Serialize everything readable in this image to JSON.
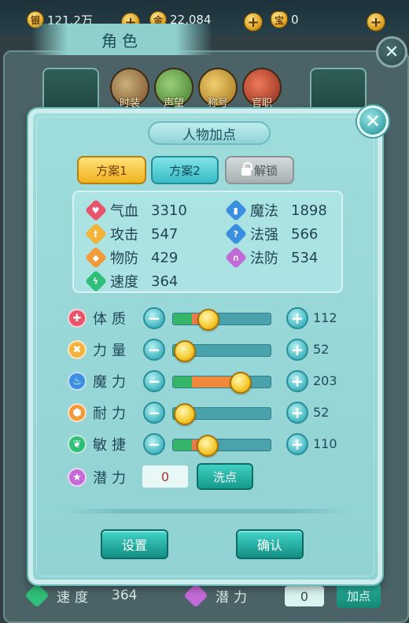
{
  "currency": {
    "silver": "121.2万",
    "gold": "22,084",
    "ingot": "0"
  },
  "background": {
    "title": "角色",
    "icons": [
      "时装",
      "声望",
      "称号",
      "官职"
    ],
    "bottom_row": {
      "speed_label": "速度",
      "speed_value": "364",
      "potential_label": "潜力",
      "potential_value": "0",
      "add_button": "加点"
    }
  },
  "dialog": {
    "title": "人物加点",
    "tabs": [
      {
        "label": "方案1",
        "state": "active"
      },
      {
        "label": "方案2",
        "state": "normal"
      },
      {
        "label": "解锁",
        "state": "locked"
      }
    ],
    "stats": [
      {
        "label": "气血",
        "value": "3310",
        "color": "#e8556b"
      },
      {
        "label": "魔法",
        "value": "1898",
        "color": "#3b8fe0"
      },
      {
        "label": "攻击",
        "value": "547",
        "color": "#f2b33a"
      },
      {
        "label": "法强",
        "value": "566",
        "color": "#3b8fe0"
      },
      {
        "label": "物防",
        "value": "429",
        "color": "#f29a3a"
      },
      {
        "label": "法防",
        "value": "534",
        "color": "#c46ad6"
      },
      {
        "label": "速度",
        "value": "364",
        "color": "#2fbf78"
      }
    ],
    "attributes": [
      {
        "label": "体质",
        "value": "112",
        "level": 0.36,
        "fill_color": "#e77b4a",
        "icon": "cross-icon",
        "icon_color": "#e8556b"
      },
      {
        "label": "力量",
        "value": "52",
        "level": 0.12,
        "fill_color": "#e77b4a",
        "icon": "swords-icon",
        "icon_color": "#f2b33a"
      },
      {
        "label": "魔力",
        "value": "203",
        "level": 0.68,
        "fill_color": "#ef8a3c",
        "icon": "flame-icon",
        "icon_color": "#3b8fe0"
      },
      {
        "label": "耐力",
        "value": "52",
        "level": 0.12,
        "fill_color": "#e77b4a",
        "icon": "shield-icon",
        "icon_color": "#f29a3a"
      },
      {
        "label": "敏捷",
        "value": "110",
        "level": 0.35,
        "fill_color": "#e77b4a",
        "icon": "leaf-icon",
        "icon_color": "#2fbf78"
      }
    ],
    "potential": {
      "label": "潜力",
      "value": "0",
      "icon_color": "#c46ad6"
    },
    "wash_button": "洗点",
    "settings_button": "设置",
    "confirm_button": "确认"
  }
}
